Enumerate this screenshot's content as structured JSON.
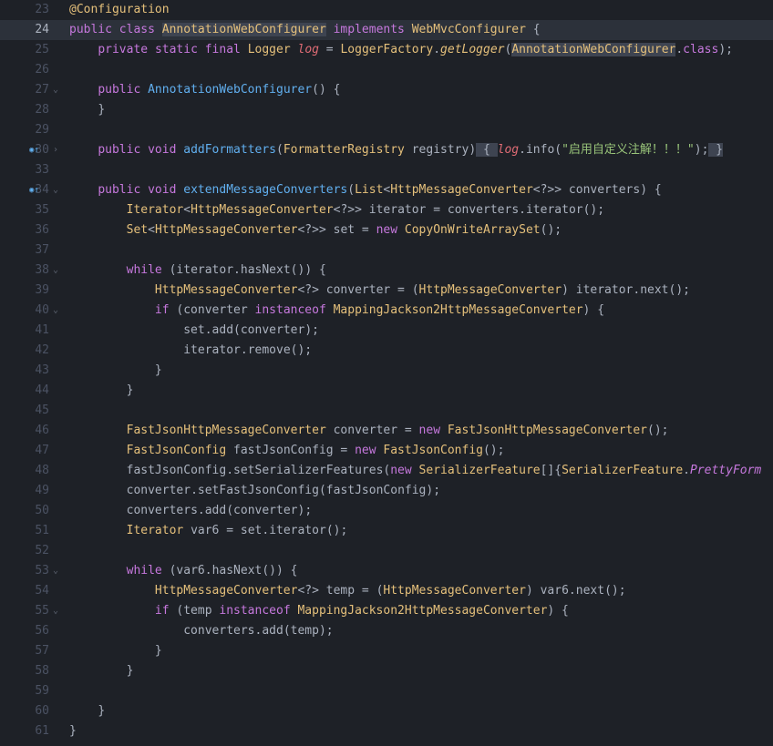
{
  "gutter": {
    "lines": [
      {
        "num": "23",
        "fold": "",
        "override": false
      },
      {
        "num": "24",
        "fold": "",
        "override": false,
        "highlighted": true
      },
      {
        "num": "25",
        "fold": "",
        "override": false
      },
      {
        "num": "26",
        "fold": "",
        "override": false
      },
      {
        "num": "27",
        "fold": "v",
        "override": false
      },
      {
        "num": "28",
        "fold": "",
        "override": false
      },
      {
        "num": "29",
        "fold": "",
        "override": false
      },
      {
        "num": "30",
        "fold": ">",
        "override": true
      },
      {
        "num": "33",
        "fold": "",
        "override": false
      },
      {
        "num": "34",
        "fold": "v",
        "override": true
      },
      {
        "num": "35",
        "fold": "",
        "override": false
      },
      {
        "num": "36",
        "fold": "",
        "override": false
      },
      {
        "num": "37",
        "fold": "",
        "override": false
      },
      {
        "num": "38",
        "fold": "v",
        "override": false
      },
      {
        "num": "39",
        "fold": "",
        "override": false
      },
      {
        "num": "40",
        "fold": "v",
        "override": false
      },
      {
        "num": "41",
        "fold": "",
        "override": false
      },
      {
        "num": "42",
        "fold": "",
        "override": false
      },
      {
        "num": "43",
        "fold": "",
        "override": false
      },
      {
        "num": "44",
        "fold": "",
        "override": false
      },
      {
        "num": "45",
        "fold": "",
        "override": false
      },
      {
        "num": "46",
        "fold": "",
        "override": false
      },
      {
        "num": "47",
        "fold": "",
        "override": false
      },
      {
        "num": "48",
        "fold": "",
        "override": false
      },
      {
        "num": "49",
        "fold": "",
        "override": false
      },
      {
        "num": "50",
        "fold": "",
        "override": false
      },
      {
        "num": "51",
        "fold": "",
        "override": false
      },
      {
        "num": "52",
        "fold": "",
        "override": false
      },
      {
        "num": "53",
        "fold": "v",
        "override": false
      },
      {
        "num": "54",
        "fold": "",
        "override": false
      },
      {
        "num": "55",
        "fold": "v",
        "override": false
      },
      {
        "num": "56",
        "fold": "",
        "override": false
      },
      {
        "num": "57",
        "fold": "",
        "override": false
      },
      {
        "num": "58",
        "fold": "",
        "override": false
      },
      {
        "num": "59",
        "fold": "",
        "override": false
      },
      {
        "num": "60",
        "fold": "",
        "override": false
      },
      {
        "num": "61",
        "fold": "",
        "override": false
      }
    ]
  },
  "code": {
    "l23": {
      "annotation": "@Configuration"
    },
    "l24": {
      "kw1": "public",
      "kw2": "class",
      "cls": "AnnotationWebConfigurer",
      "kw3": "implements",
      "iface": "WebMvcConfigurer",
      "brace": " {"
    },
    "l25": {
      "kw1": "private",
      "kw2": "static",
      "kw3": "final",
      "type": "Logger",
      "var": "log",
      "eq": " = ",
      "factory": "LoggerFactory",
      "dot": ".",
      "method": "getLogger",
      "open": "(",
      "arg": "AnnotationWebConfigurer",
      "dotclass": ".",
      "classkw": "class",
      "close": ");"
    },
    "l27": {
      "kw1": "public",
      "ctor": "AnnotationWebConfigurer",
      "parens": "()",
      "brace": " {"
    },
    "l28": {
      "brace": "}"
    },
    "l30": {
      "kw1": "public",
      "kw2": "void",
      "method": "addFormatters",
      "open": "(",
      "ptype": "FormatterRegistry",
      "pname": " registry",
      "close": ")",
      "fbrace1": " { ",
      "logvar": "log",
      "dot": ".",
      "info": "info",
      "popen": "(",
      "str": "\"启用自定义注解！！！\"",
      "pclose": ");",
      "fbrace2": " }"
    },
    "l34": {
      "kw1": "public",
      "kw2": "void",
      "method": "extendMessageConverters",
      "open": "(",
      "ptype": "List",
      "lt": "<",
      "gtype": "HttpMessageConverter",
      "wild": "<?>",
      "gt": ">",
      "pname": " converters",
      "close": ")",
      "brace": " {"
    },
    "l35": {
      "type": "Iterator",
      "lt": "<",
      "gtype": "HttpMessageConverter",
      "wild": "<?>",
      "gt": ">",
      "var": " iterator",
      "eq": " = ",
      "obj": "converters",
      "dot": ".",
      "method": "iterator",
      "call": "();"
    },
    "l36": {
      "type": "Set",
      "lt": "<",
      "gtype": "HttpMessageConverter",
      "wild": "<?>",
      "gt": ">",
      "var": " set",
      "eq": " = ",
      "kwnew": "new",
      "ctor": " CopyOnWriteArraySet",
      "call": "();"
    },
    "l38": {
      "kw": "while",
      "open": " (",
      "obj": "iterator",
      "dot": ".",
      "method": "hasNext",
      "call": "())",
      "brace": " {"
    },
    "l39": {
      "type": "HttpMessageConverter",
      "wild": "<?>",
      "var": " converter",
      "eq": " = (",
      "cast": "HttpMessageConverter",
      "close": ") ",
      "obj": "iterator",
      "dot": ".",
      "method": "next",
      "call": "();"
    },
    "l40": {
      "kw": "if",
      "open": " (",
      "obj": "converter",
      "inst": " instanceof ",
      "type": "MappingJackson2HttpMessageConverter",
      "close": ")",
      "brace": " {"
    },
    "l41": {
      "obj": "set",
      "dot": ".",
      "method": "add",
      "open": "(",
      "arg": "converter",
      "close": ");"
    },
    "l42": {
      "obj": "iterator",
      "dot": ".",
      "method": "remove",
      "call": "();"
    },
    "l43": {
      "brace": "}"
    },
    "l44": {
      "brace": "}"
    },
    "l46": {
      "type": "FastJsonHttpMessageConverter",
      "var": " converter",
      "eq": " = ",
      "kwnew": "new",
      "ctor": " FastJsonHttpMessageConverter",
      "call": "();"
    },
    "l47": {
      "type": "FastJsonConfig",
      "var": " fastJsonConfig",
      "eq": " = ",
      "kwnew": "new",
      "ctor": " FastJsonConfig",
      "call": "();"
    },
    "l48": {
      "obj": "fastJsonConfig",
      "dot": ".",
      "method": "setSerializerFeatures",
      "open": "(",
      "kwnew": "new",
      "arrtype": " SerializerFeature",
      "arr": "[]{",
      "enum": "SerializerFeature",
      "edot": ".",
      "member": "PrettyForm"
    },
    "l49": {
      "obj": "converter",
      "dot": ".",
      "method": "setFastJsonConfig",
      "open": "(",
      "arg": "fastJsonConfig",
      "close": ");"
    },
    "l50": {
      "obj": "converters",
      "dot": ".",
      "method": "add",
      "open": "(",
      "arg": "converter",
      "close": ");"
    },
    "l51": {
      "type": "Iterator",
      "var": " var6",
      "eq": " = ",
      "obj": "set",
      "dot": ".",
      "method": "iterator",
      "call": "();"
    },
    "l53": {
      "kw": "while",
      "open": " (",
      "obj": "var6",
      "dot": ".",
      "method": "hasNext",
      "call": "())",
      "brace": " {"
    },
    "l54": {
      "type": "HttpMessageConverter",
      "wild": "<?>",
      "var": " temp",
      "eq": " = (",
      "cast": "HttpMessageConverter",
      "close": ") ",
      "obj": "var6",
      "dot": ".",
      "method": "next",
      "call": "();"
    },
    "l55": {
      "kw": "if",
      "open": " (",
      "obj": "temp",
      "inst": " instanceof ",
      "type": "MappingJackson2HttpMessageConverter",
      "close": ")",
      "brace": " {"
    },
    "l56": {
      "obj": "converters",
      "dot": ".",
      "method": "add",
      "open": "(",
      "arg": "temp",
      "close": ");"
    },
    "l57": {
      "brace": "}"
    },
    "l58": {
      "brace": "}"
    },
    "l60": {
      "brace": "}"
    },
    "l61": {
      "brace": "}"
    }
  }
}
